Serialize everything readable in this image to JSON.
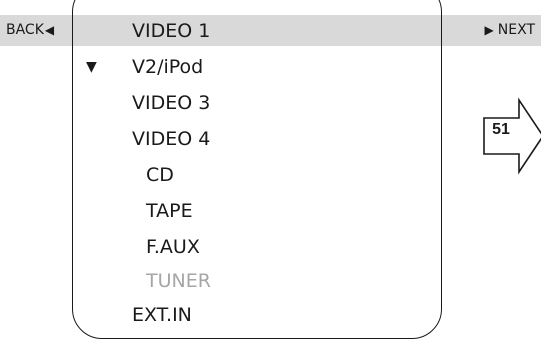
{
  "nav": {
    "back_label": "BACK",
    "back_arrow": "◀",
    "next_label": "NEXT",
    "next_arrow": "▶"
  },
  "menu": {
    "items": [
      {
        "label": "VIDEO 1",
        "selected": true
      },
      {
        "label": "V2/iPod",
        "checked": true,
        "check_glyph": "▼"
      },
      {
        "label": "VIDEO 3"
      },
      {
        "label": "VIDEO 4"
      },
      {
        "label": "CD"
      },
      {
        "label": "TAPE"
      },
      {
        "label": "F.AUX"
      },
      {
        "label": "TUNER",
        "dimmed": true
      },
      {
        "label": "EXT.IN"
      }
    ]
  },
  "page_reference": {
    "page": "51"
  },
  "colors": {
    "highlight": "#d9d9d9",
    "text": "#1a1a1a",
    "dimmed_text": "#a6a6a6"
  }
}
